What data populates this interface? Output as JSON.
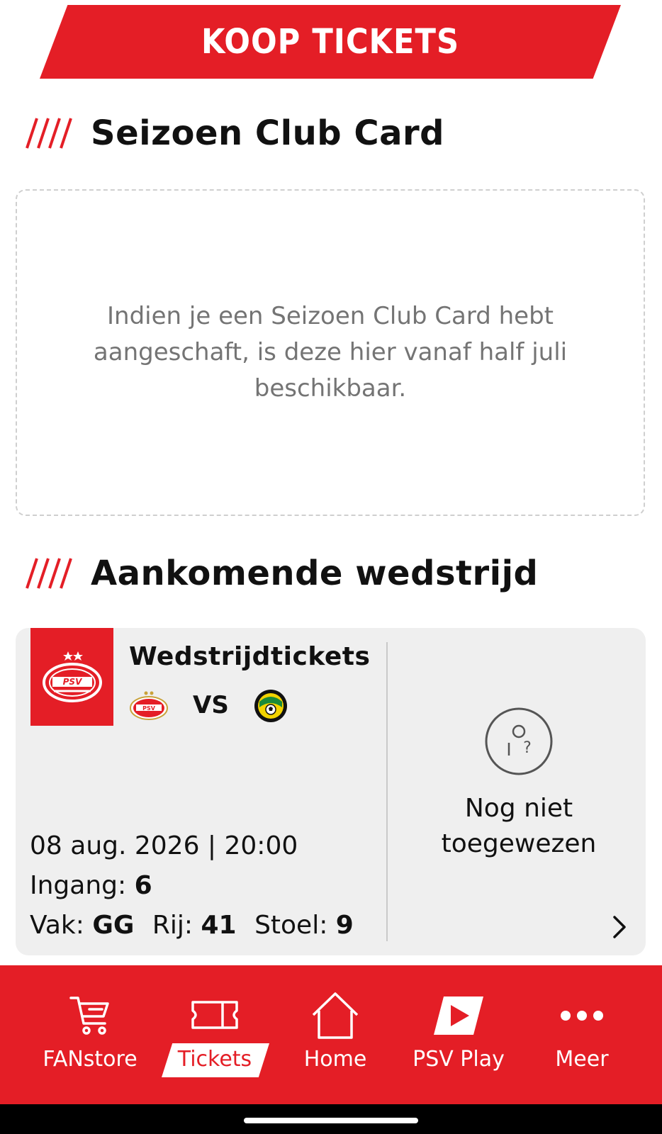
{
  "header": {
    "buy_tickets": "KOOP TICKETS"
  },
  "season_card": {
    "title": "Seizoen Club Card",
    "message": "Indien je een Seizoen Club Card hebt aangeschaft, is deze hier vanaf half juli beschikbaar."
  },
  "upcoming": {
    "title": "Aankomende wedstrijd",
    "ticket_title": "Wedstrijdtickets",
    "vs_label": "VS",
    "date_time": "08 aug. 2026 | 20:00",
    "entrance_label": "Ingang:",
    "entrance_value": "6",
    "section_label": "Vak:",
    "section_value": "GG",
    "row_label": "Rij:",
    "row_value": "41",
    "seat_label": "Stoel:",
    "seat_value": "9",
    "status_line1": "Nog niet",
    "status_line2": "toegewezen",
    "home_team_logo": "psv-logo",
    "away_team_logo": "fortuna-sittard-logo"
  },
  "bottom_nav": {
    "items": [
      {
        "label": "FANstore",
        "icon": "cart-icon",
        "active": false
      },
      {
        "label": "Tickets",
        "icon": "ticket-icon",
        "active": true
      },
      {
        "label": "Home",
        "icon": "home-icon",
        "active": false
      },
      {
        "label": "PSV Play",
        "icon": "play-icon",
        "active": false
      },
      {
        "label": "Meer",
        "icon": "more-icon",
        "active": false
      }
    ]
  },
  "colors": {
    "brand_red": "#e41e26",
    "card_bg": "#efefef",
    "muted_text": "#747474"
  }
}
